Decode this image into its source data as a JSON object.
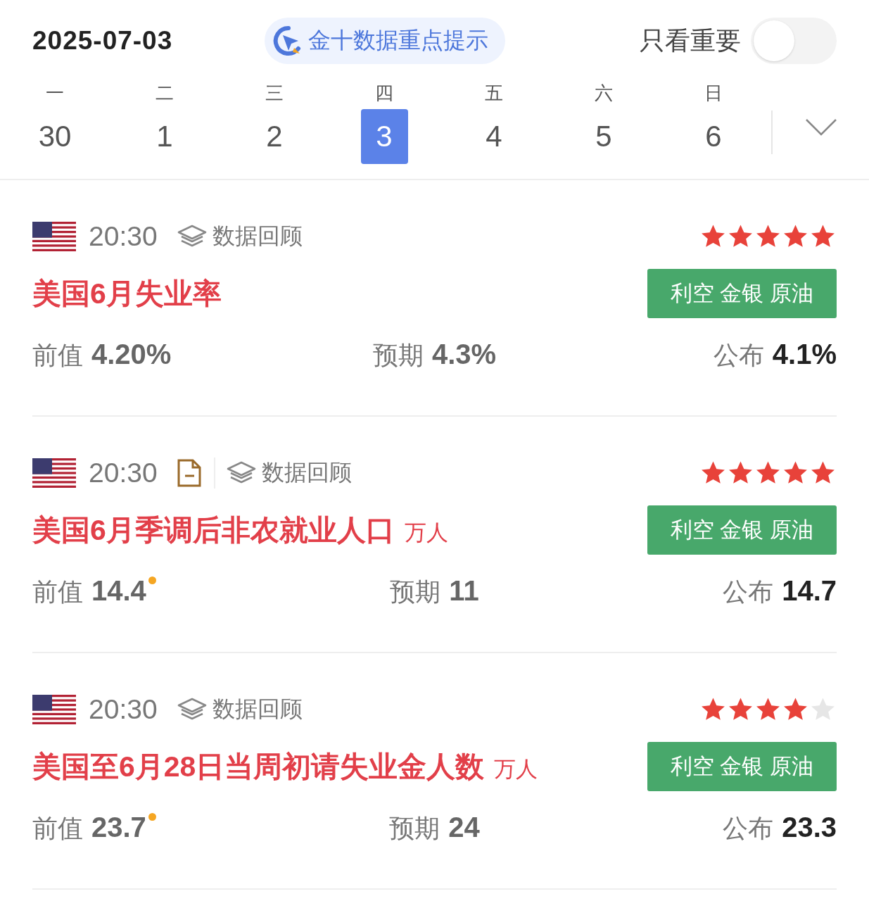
{
  "date": "2025-07-03",
  "highlight_button": "金十数据重点提示",
  "important_only": {
    "label": "只看重要",
    "on": false
  },
  "week": [
    {
      "weekday": "一",
      "day": "30",
      "selected": false
    },
    {
      "weekday": "二",
      "day": "1",
      "selected": false
    },
    {
      "weekday": "三",
      "day": "2",
      "selected": false
    },
    {
      "weekday": "四",
      "day": "3",
      "selected": true
    },
    {
      "weekday": "五",
      "day": "4",
      "selected": false
    },
    {
      "weekday": "六",
      "day": "5",
      "selected": false
    },
    {
      "weekday": "日",
      "day": "6",
      "selected": false
    }
  ],
  "events": [
    {
      "time": "20:30",
      "has_report": false,
      "review_label": "数据回顾",
      "stars": 5,
      "title": "美国6月失业率",
      "tag": "利空 金银 原油",
      "previous": {
        "label": "前值",
        "value": "4.20%",
        "revised": false
      },
      "forecast": {
        "label": "预期",
        "value": "4.3%"
      },
      "actual": {
        "label": "公布",
        "value": "4.1%"
      }
    },
    {
      "time": "20:30",
      "has_report": true,
      "review_label": "数据回顾",
      "stars": 5,
      "title": "美国6月季调后非农就业人口",
      "unit": "万人",
      "tag": "利空 金银 原油",
      "previous": {
        "label": "前值",
        "value": "14.4",
        "revised": true
      },
      "forecast": {
        "label": "预期",
        "value": "11"
      },
      "actual": {
        "label": "公布",
        "value": "14.7"
      }
    },
    {
      "time": "20:30",
      "has_report": false,
      "review_label": "数据回顾",
      "stars": 4,
      "title": "美国至6月28日当周初请失业金人数",
      "unit": "万人",
      "tag": "利空 金银 原油",
      "previous": {
        "label": "前值",
        "value": "23.7",
        "revised": true
      },
      "forecast": {
        "label": "预期",
        "value": "24"
      },
      "actual": {
        "label": "公布",
        "value": "23.3"
      }
    }
  ]
}
